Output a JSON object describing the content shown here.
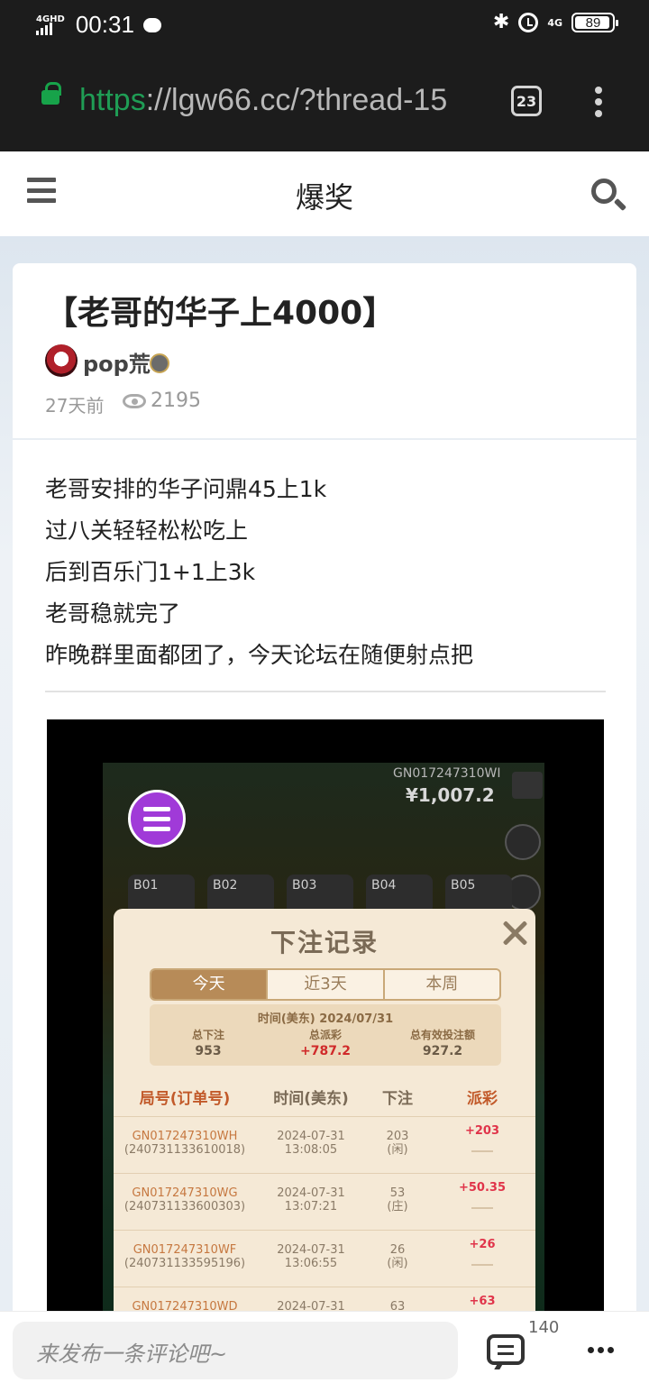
{
  "status_bar": {
    "signal": "4GHD",
    "time": "00:31",
    "network": "4G",
    "battery": "89"
  },
  "browser": {
    "url_scheme": "https",
    "url_rest": "://lgw66.cc/?thread-15",
    "tab_count": "23"
  },
  "header": {
    "title": "爆奖"
  },
  "post": {
    "title": "【老哥的华子上4000】",
    "author": "pop荒",
    "time": "27天前",
    "views": "2195",
    "lines": [
      "老哥安排的华子问鼎45上1k",
      "过八关轻轻松松吃上",
      "后到百乐门1+1上3k",
      "老哥稳就完了",
      "昨晚群里面都团了，今天论坛在随便射点把"
    ]
  },
  "screenshot": {
    "game_id": "GN017247310WI",
    "balance": "¥1,007.2",
    "tables": [
      "B01",
      "B02",
      "B03",
      "B04",
      "B05"
    ],
    "modal": {
      "title": "下注记录",
      "tabs": [
        "今天",
        "近3天",
        "本周"
      ],
      "summary_date": "时间(美东) 2024/07/31",
      "total_bet_label": "总下注",
      "total_bet": "953",
      "total_payout_label": "总派彩",
      "total_payout": "+787.2",
      "valid_bet_label": "总有效投注额",
      "valid_bet": "927.2",
      "columns": [
        "局号(订单号)",
        "时间(美东)",
        "下注",
        "派彩"
      ],
      "rows": [
        {
          "id": "GN017247310WH",
          "order": "(240731133610018)",
          "date": "2024-07-31",
          "time": "13:08:05",
          "bet": "203",
          "side": "(闲)",
          "payout": "+203"
        },
        {
          "id": "GN017247310WG",
          "order": "(240731133600303)",
          "date": "2024-07-31",
          "time": "13:07:21",
          "bet": "53",
          "side": "(庄)",
          "payout": "+50.35"
        },
        {
          "id": "GN017247310WF",
          "order": "(240731133595196)",
          "date": "2024-07-31",
          "time": "13:06:55",
          "bet": "26",
          "side": "(闲)",
          "payout": "+26"
        },
        {
          "id": "GN017247310WD",
          "order": "",
          "date": "2024-07-31",
          "time": "",
          "bet": "63",
          "side": "",
          "payout": "+63"
        }
      ]
    }
  },
  "bottom": {
    "comment_placeholder": "来发布一条评论吧~",
    "comment_count": "140"
  }
}
